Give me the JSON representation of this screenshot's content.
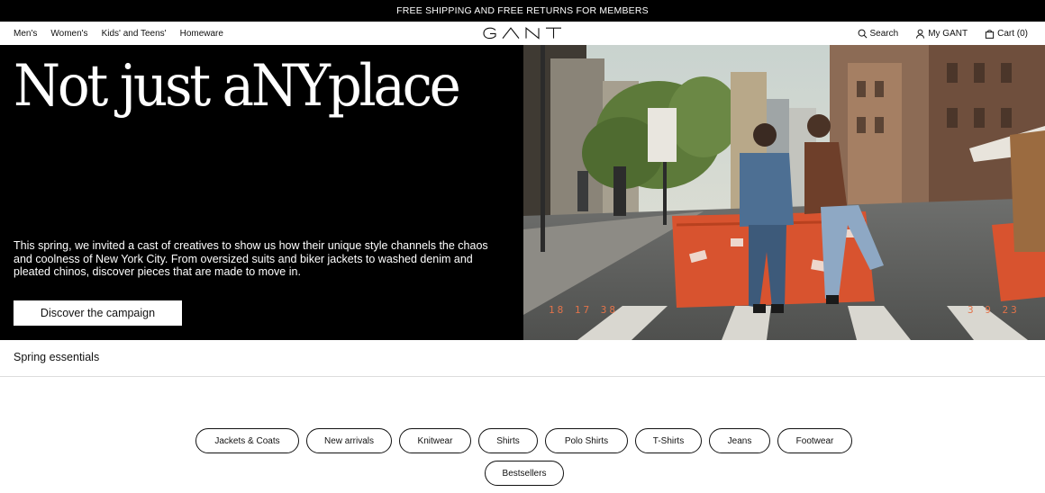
{
  "promo": {
    "text": "FREE SHIPPING AND FREE RETURNS FOR MEMBERS"
  },
  "nav": {
    "left": [
      "Men's",
      "Women's",
      "Kids' and Teens'",
      "Homeware"
    ],
    "brand": "GANT",
    "search": "Search",
    "account": "My GANT",
    "cart": "Cart (0)"
  },
  "hero": {
    "title": "Not just aNYplace",
    "text": "This spring, we invited a cast of creatives to show us how their unique style channels the chaos and coolness of New York City. From oversized suits and biker jackets to washed denim and pleated chinos, discover pieces that are made to move in.",
    "cta": "Discover the campaign",
    "stamp_time": "18 17 38",
    "stamp_date": "3 9 23"
  },
  "section": {
    "title": "Spring essentials"
  },
  "categories": {
    "row1": [
      "Jackets & Coats",
      "New arrivals",
      "Knitwear",
      "Shirts",
      "Polo Shirts",
      "T-Shirts",
      "Jeans",
      "Footwear"
    ],
    "row2": [
      "Bestsellers"
    ]
  },
  "colors": {
    "background": "#000000",
    "accent": "#e2734a"
  }
}
